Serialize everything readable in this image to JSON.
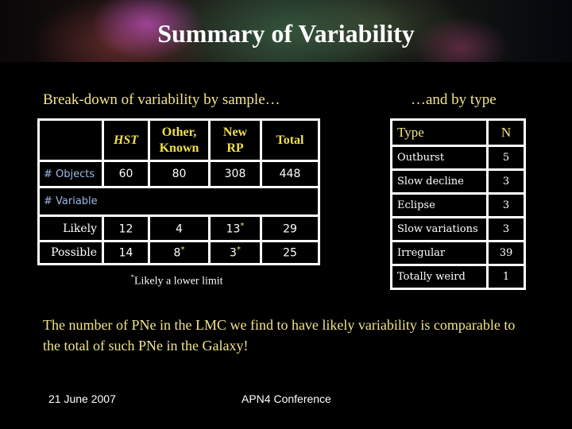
{
  "slide": {
    "title": "Summary of Variability",
    "left_heading": "Break-down of variability by sample…",
    "right_heading": "…and by type",
    "conclusion": "The number of PNe in the LMC we find to have likely variability is comparable to the total of such PNe in the Galaxy!",
    "footer_date": "21 June 2007",
    "footer_event": "APN4 Conference"
  },
  "sample_table": {
    "headers": [
      "",
      "HST",
      "Other, Known",
      "New RP",
      "Total"
    ],
    "header_lines": {
      "other": [
        "Other,",
        "Known"
      ],
      "newrp": [
        "New",
        "RP"
      ]
    },
    "objects_row": {
      "label": "# Objects",
      "values": [
        "60",
        "80",
        "308",
        "448"
      ]
    },
    "variable_label": "# Variable",
    "likely_row": {
      "label": "Likely",
      "values": [
        "12",
        "4",
        "13",
        "29"
      ],
      "marks": [
        "",
        "",
        "*",
        ""
      ]
    },
    "possible_row": {
      "label": "Possible",
      "values": [
        "14",
        "8",
        "3",
        "25"
      ],
      "marks": [
        "",
        "*",
        "*",
        ""
      ]
    },
    "footnote_mark": "*",
    "footnote": "Likely a lower limit"
  },
  "type_table": {
    "headers": [
      "Type",
      "N"
    ],
    "rows": [
      {
        "type": "Outburst",
        "n": "5"
      },
      {
        "type": "Slow decline",
        "n": "3"
      },
      {
        "type": "Eclipse",
        "n": "3"
      },
      {
        "type": "Slow variations",
        "n": "3"
      },
      {
        "type": "Irregular",
        "n": "39"
      },
      {
        "type": "Totally weird",
        "n": "1"
      }
    ]
  },
  "colors": {
    "heading_yellow": "#f0e48a",
    "header_yellow": "#f0e04a",
    "row_label_blue": "#9fb8e6",
    "background": "#000000"
  }
}
